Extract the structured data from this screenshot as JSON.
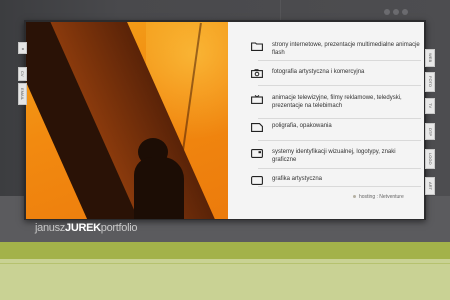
{
  "logo": {
    "part1": "janusz",
    "part2": "JUREK",
    "part3": "portfolio"
  },
  "menu": [
    {
      "icon": "folder-icon",
      "text": "strony internetowe, prezentacje multimedialne animacje flash"
    },
    {
      "icon": "camera-icon",
      "text": "fotografia artystyczna i komercyjna"
    },
    {
      "icon": "tv-icon",
      "text": "animacje telewizyjne, filmy reklamowe, teledyski, prezentacje na telebimach"
    },
    {
      "icon": "label-icon",
      "text": "poligrafia, opakowania"
    },
    {
      "icon": "card-icon",
      "text": "systemy identyfikacji wizualnej, logotypy, znaki graficzne"
    },
    {
      "icon": "frame-icon",
      "text": "grafika artystyczna"
    }
  ],
  "footer": {
    "link": "hosting : Netventure"
  },
  "right_tabs": [
    "WEB",
    "FOTO",
    "TV",
    "DTP",
    "LOGO",
    "ART"
  ],
  "left_tabs": [
    "◂",
    "CV",
    "EMAIL"
  ]
}
